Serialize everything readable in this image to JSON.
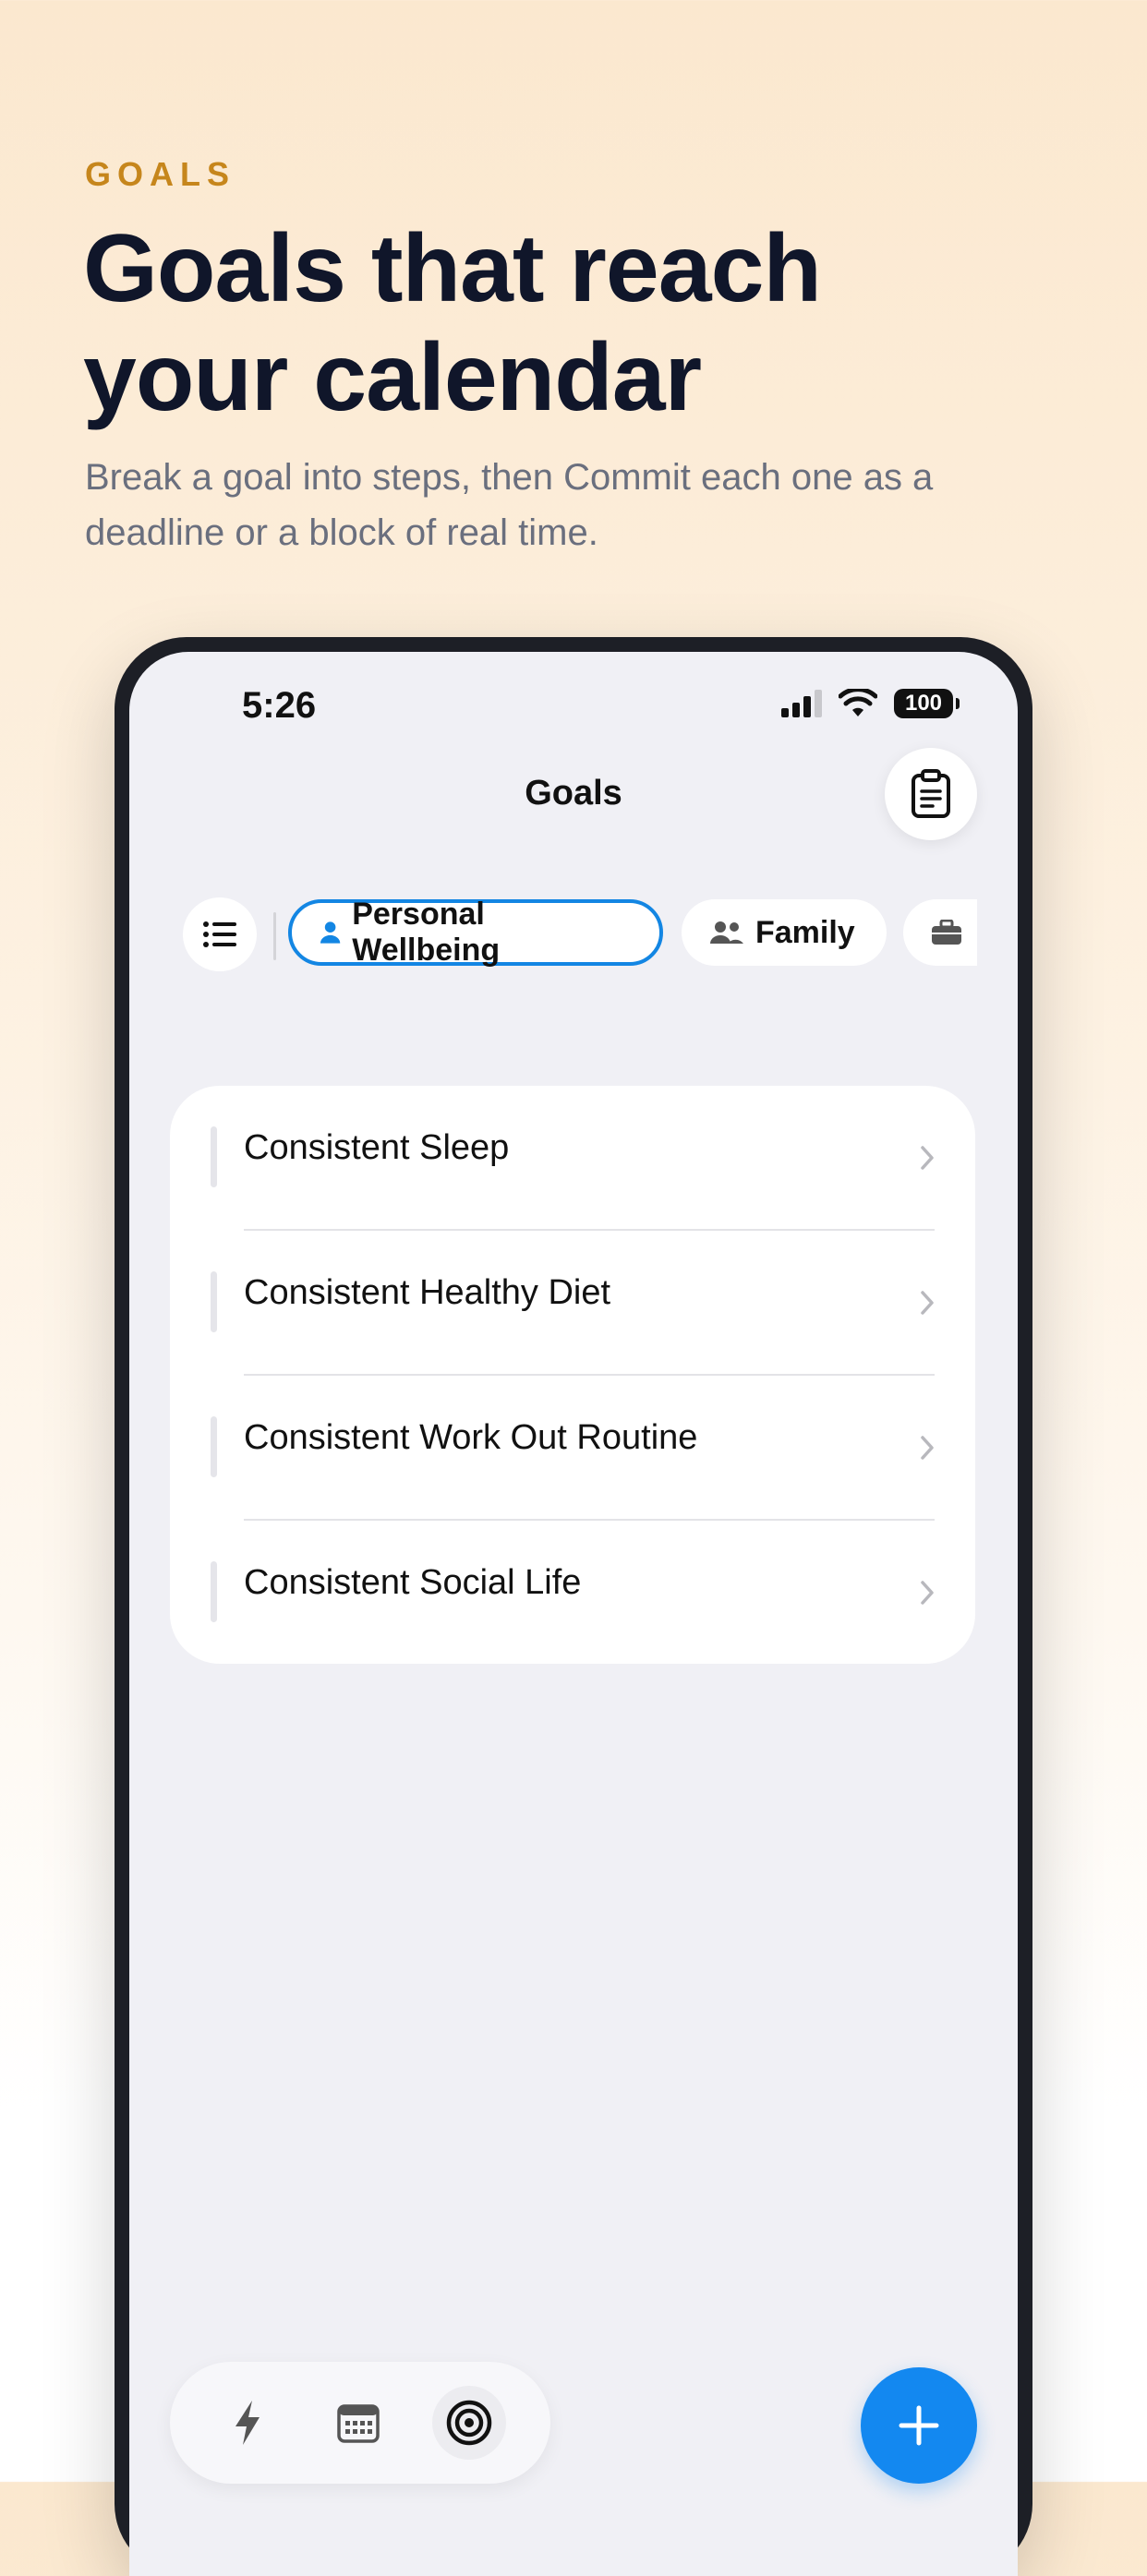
{
  "hero": {
    "eyebrow": "GOALS",
    "headline_line1": "Goals that reach",
    "headline_line2": "your calendar",
    "subtitle": "Break a goal into steps, then Commit each one as a deadline or a block of real time."
  },
  "status_bar": {
    "time": "5:26",
    "battery": "100"
  },
  "nav": {
    "title": "Goals"
  },
  "chips": [
    {
      "label": "Personal Wellbeing",
      "icon": "person-icon",
      "active": true
    },
    {
      "label": "Family",
      "icon": "people-icon",
      "active": false
    },
    {
      "label": "",
      "icon": "briefcase-icon",
      "active": false
    }
  ],
  "goals": [
    {
      "label": "Consistent Sleep"
    },
    {
      "label": "Consistent Healthy Diet"
    },
    {
      "label": "Consistent Work Out Routine"
    },
    {
      "label": "Consistent Social Life"
    }
  ],
  "tabbar": [
    {
      "icon": "bolt-icon"
    },
    {
      "icon": "calendar-icon"
    },
    {
      "icon": "target-icon",
      "active": true
    }
  ],
  "fab": {
    "icon": "plus-icon"
  },
  "colors": {
    "accent": "#1386e3",
    "eyebrow": "#c6861c",
    "headline": "#10162a"
  }
}
